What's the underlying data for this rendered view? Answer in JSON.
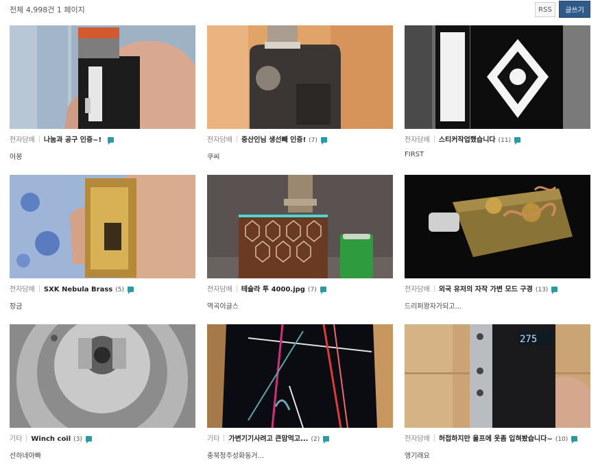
{
  "header": {
    "summary": "전체 4,998건 1 페이지",
    "rss_label": "RSS",
    "write_label": "글쓰기"
  },
  "posts": [
    {
      "category": "전자담배",
      "title": "나눔과 공구 인증~!",
      "count": "",
      "author": "어봉"
    },
    {
      "category": "전자담배",
      "title": "중산인님 생선빼 인증!",
      "count": "(7)",
      "author": "쿠씨"
    },
    {
      "category": "전자담배",
      "title": "스티커작업했습니다",
      "count": "(11)",
      "author": "FIRST"
    },
    {
      "category": "전자담배",
      "title": "SXK Nebula Brass",
      "count": "(5)",
      "author": "장금"
    },
    {
      "category": "전자담배",
      "title": "테슬라 투 4000.jpg",
      "count": "(7)",
      "author": "역곡이글스"
    },
    {
      "category": "전자담배",
      "title": "외국 유저의 자작 가변 모드 구경",
      "count": "(13)",
      "author": "드리퍼왕자가되고..."
    },
    {
      "category": "기타",
      "title": "Winch coil",
      "count": "(3)",
      "author": "선하네아빠"
    },
    {
      "category": "기타",
      "title": "가변기기사려고 큰맘먹고...",
      "count": "(2)",
      "author": "충북청주성화동거..."
    },
    {
      "category": "전자담배",
      "title": "허접하지만 울프에 옷좀 입혀봤습니다~",
      "count": "(10)",
      "author": "앵기래요"
    }
  ],
  "thumbnails": [
    {
      "subject": "black-vape-mod-in-hand"
    },
    {
      "subject": "dark-grey-box-mod"
    },
    {
      "subject": "sticker-covered-mods"
    },
    {
      "subject": "brass-mod-in-hand"
    },
    {
      "subject": "hexagon-mod-with-battery"
    },
    {
      "subject": "brass-steampunk-mod"
    },
    {
      "subject": "rebuildable-atomizer-deck"
    },
    {
      "subject": "phone-with-light-lines"
    },
    {
      "subject": "silver-box-mod-display",
      "display_text": "275"
    }
  ]
}
